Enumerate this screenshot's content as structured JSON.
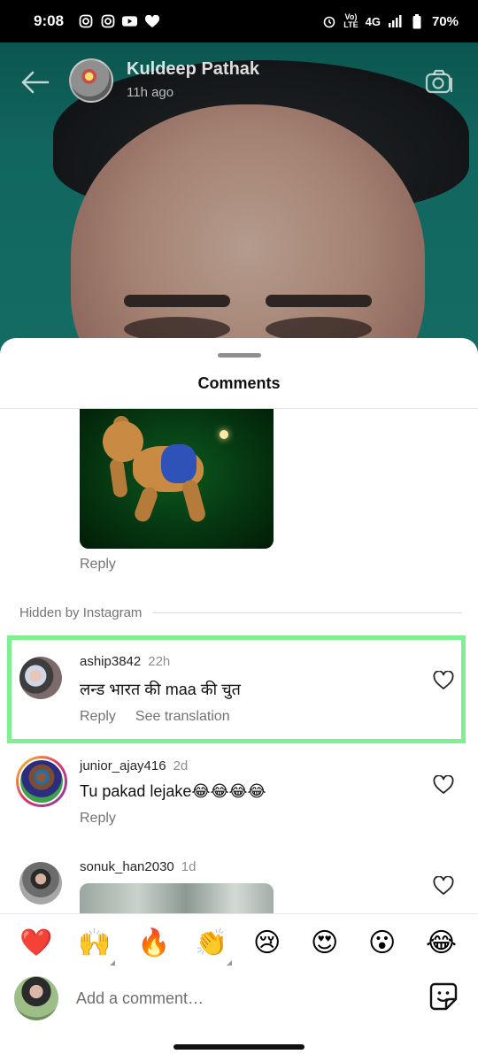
{
  "status_bar": {
    "time": "9:08",
    "network": "4G",
    "battery": "70%",
    "icons_left": [
      "instagram-icon",
      "instagram-icon",
      "youtube-icon",
      "heart-icon"
    ],
    "icons_right": [
      "alarm-icon",
      "volte-icon",
      "signal-icon",
      "battery-icon"
    ]
  },
  "story": {
    "owner_name": "Kuldeep Pathak",
    "owner_time": "11h ago"
  },
  "sheet": {
    "title": "Comments",
    "hidden_label": "Hidden by Instagram"
  },
  "comments": [
    {
      "reply": "Reply"
    },
    {
      "username": "aship3842",
      "time": "22h",
      "text": "लन्ड भारत की maa की चुत",
      "reply": "Reply",
      "see_translation": "See translation"
    },
    {
      "username": "junior_ajay416",
      "time": "2d",
      "text": "Tu pakad lejake😂😂😂😂",
      "reply": "Reply"
    },
    {
      "username": "sonuk_han2030",
      "time": "1d"
    }
  ],
  "emoji_bar": [
    "❤️",
    "🙌",
    "🔥",
    "👏",
    "😢",
    "😍",
    "😮",
    "😂"
  ],
  "compose": {
    "placeholder": "Add a comment…"
  },
  "colors": {
    "highlight": "#7ef08f",
    "text_secondary": "#737373"
  }
}
